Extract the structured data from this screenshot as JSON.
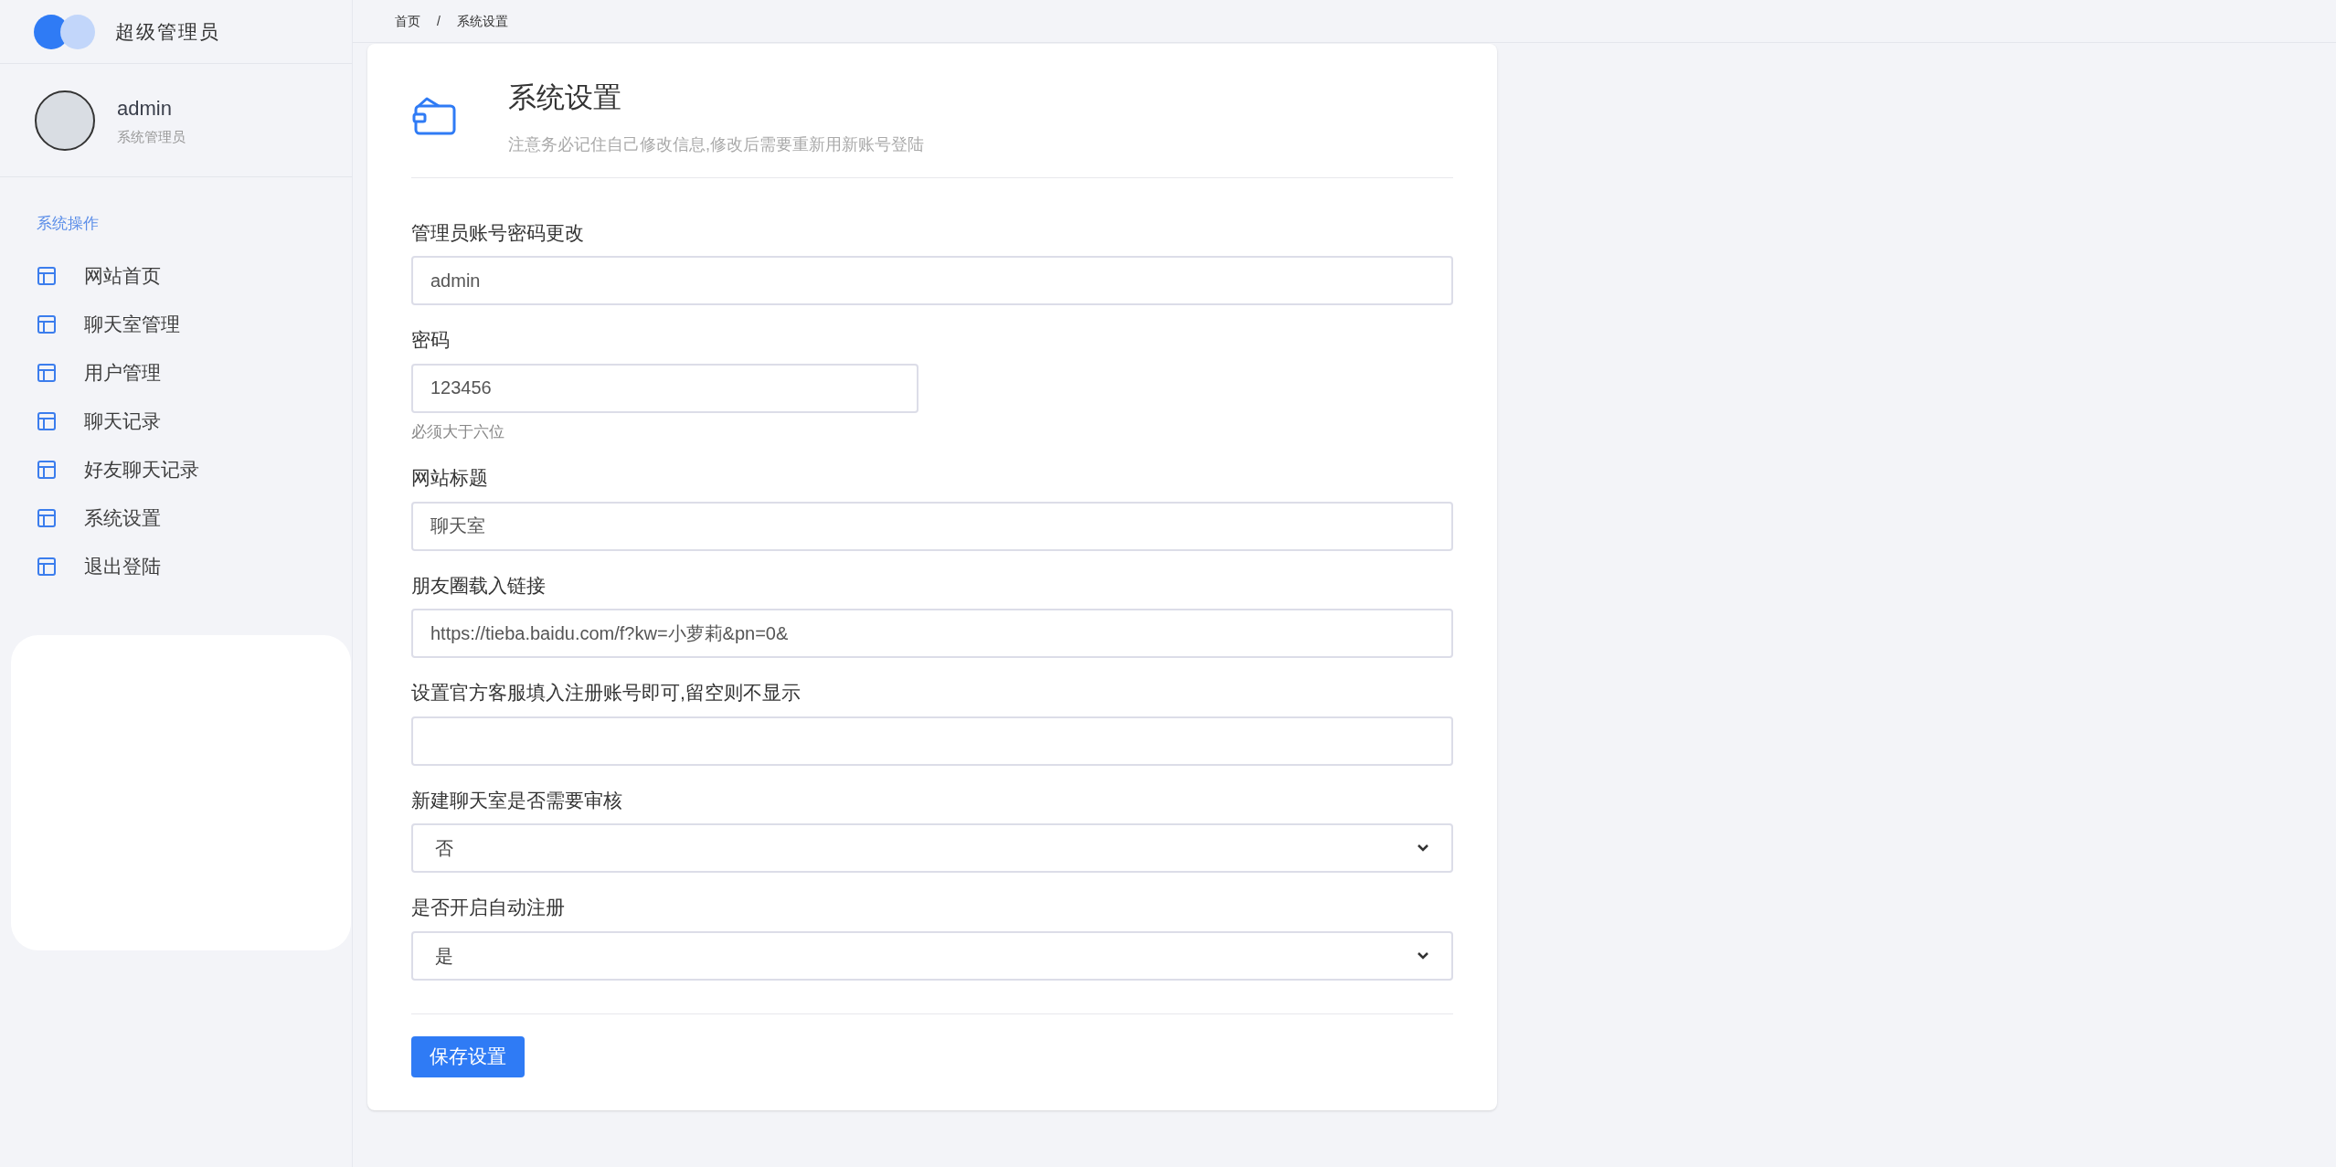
{
  "brand": {
    "title": "超级管理员"
  },
  "user": {
    "name": "admin",
    "role": "系统管理员"
  },
  "sidebar": {
    "section": "系统操作",
    "items": [
      {
        "label": "网站首页"
      },
      {
        "label": "聊天室管理"
      },
      {
        "label": "用户管理"
      },
      {
        "label": "聊天记录"
      },
      {
        "label": "好友聊天记录"
      },
      {
        "label": "系统设置"
      },
      {
        "label": "退出登陆"
      }
    ]
  },
  "breadcrumb": {
    "items": [
      "首页",
      "系统设置"
    ],
    "separator": "/"
  },
  "card": {
    "title": "系统设置",
    "subtitle": "注意务必记住自己修改信息,修改后需要重新用新账号登陆",
    "fields": [
      {
        "kind": "input",
        "label": "管理员账号密码更改",
        "value": "admin"
      },
      {
        "kind": "input",
        "label": "密码",
        "value": "123456",
        "narrow": true,
        "help": "必须大于六位"
      },
      {
        "kind": "input",
        "label": "网站标题",
        "value": "聊天室"
      },
      {
        "kind": "input",
        "label": "朋友圈载入链接",
        "value": "https://tieba.baidu.com/f?kw=小萝莉&pn=0&"
      },
      {
        "kind": "input",
        "label": "设置官方客服填入注册账号即可,留空则不显示"
      },
      {
        "kind": "select",
        "label": "新建聊天室是否需要审核",
        "value": "否"
      },
      {
        "kind": "select",
        "label": "是否开启自动注册",
        "value": "是"
      }
    ],
    "button": "保存设置"
  }
}
